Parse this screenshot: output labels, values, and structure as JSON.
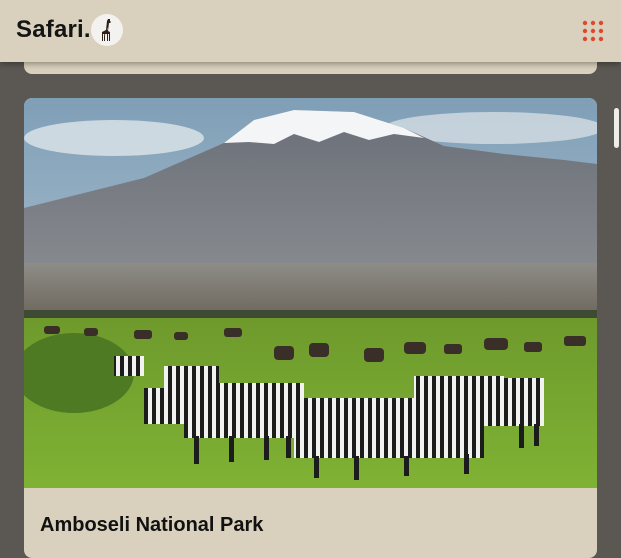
{
  "header": {
    "logo_text": "Safari.",
    "logo_icon": "giraffe-icon",
    "menu_icon": "grid-menu-icon"
  },
  "colors": {
    "header_bg": "#d9d1bd",
    "page_bg": "#5b5853",
    "menu_dots": "#e0472c"
  },
  "card": {
    "title": "Amboseli National Park",
    "image": "mountain-zebra-photo"
  }
}
